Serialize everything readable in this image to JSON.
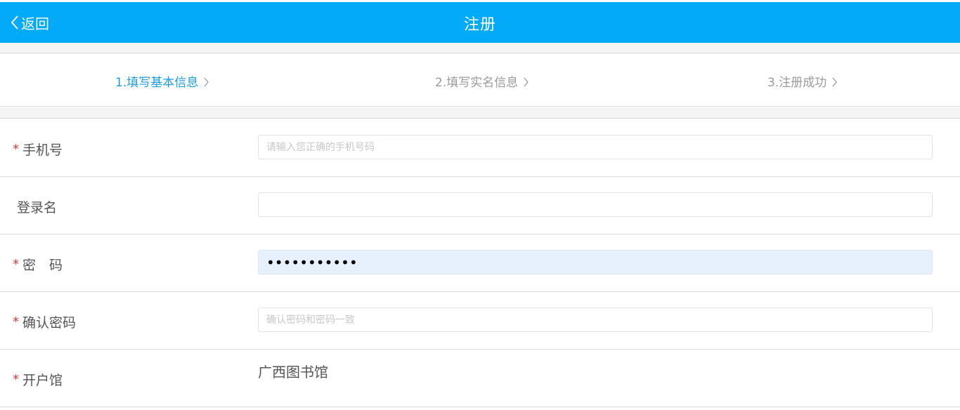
{
  "header": {
    "back_label": "返回",
    "title": "注册",
    "bg_color": "#02aaf8"
  },
  "steps": [
    {
      "label": "1.填写基本信息",
      "active": true
    },
    {
      "label": "2.填写实名信息",
      "active": false
    },
    {
      "label": "3.注册成功",
      "active": false
    }
  ],
  "form": {
    "required_mark": "*",
    "phone": {
      "label": "手机号",
      "placeholder": "请输入您正确的手机号码",
      "value": ""
    },
    "login_name": {
      "label": "登录名",
      "placeholder": "",
      "value": ""
    },
    "password": {
      "label": "密　码",
      "value": "•••••••••••"
    },
    "confirm_password": {
      "label": "确认密码",
      "placeholder": "确认密码和密码一致",
      "value": ""
    },
    "library": {
      "label": "开户馆",
      "value": "广西图书馆"
    }
  }
}
